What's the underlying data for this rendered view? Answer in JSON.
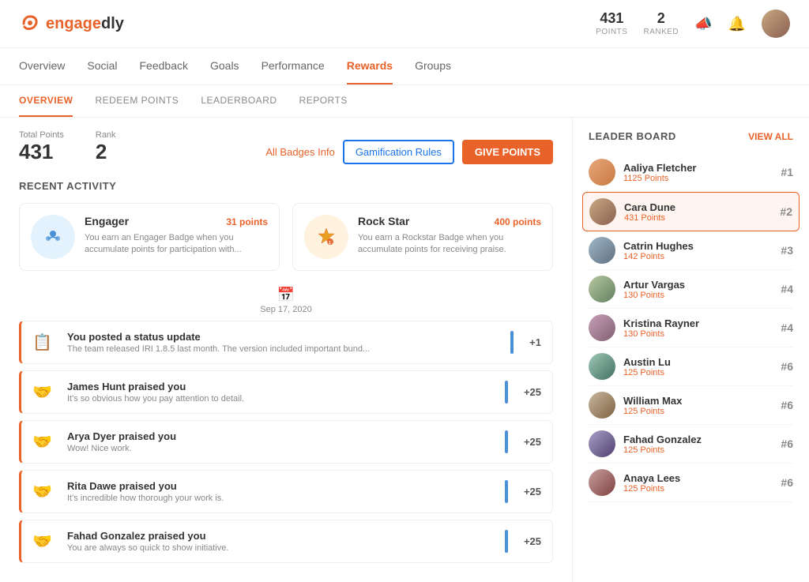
{
  "header": {
    "logo_text": "engagedly",
    "points_value": "431",
    "points_label": "POINTS",
    "ranked_value": "2",
    "ranked_label": "RANKED"
  },
  "main_nav": {
    "items": [
      {
        "label": "Overview",
        "active": false
      },
      {
        "label": "Social",
        "active": false
      },
      {
        "label": "Feedback",
        "active": false
      },
      {
        "label": "Goals",
        "active": false
      },
      {
        "label": "Performance",
        "active": false
      },
      {
        "label": "Rewards",
        "active": true
      },
      {
        "label": "Groups",
        "active": false
      }
    ]
  },
  "sub_nav": {
    "items": [
      {
        "label": "OVERVIEW",
        "active": true
      },
      {
        "label": "REDEEM POINTS",
        "active": false
      },
      {
        "label": "LEADERBOARD",
        "active": false
      },
      {
        "label": "REPORTS",
        "active": false
      }
    ]
  },
  "stats": {
    "total_points_label": "Total Points",
    "total_points_value": "431",
    "rank_label": "Rank",
    "rank_value": "2"
  },
  "buttons": {
    "all_badges_info": "All Badges Info",
    "gamification_rules": "Gamification Rules",
    "give_points": "GIVE POINTS"
  },
  "recent_activity": {
    "section_title": "RECENT ACTIVITY",
    "badges": [
      {
        "title": "Engager",
        "points": "31 points",
        "description": "You earn an Engager Badge when you accumulate points for participation with...",
        "icon_type": "blue"
      },
      {
        "title": "Rock Star",
        "points": "400 points",
        "description": "You earn a Rockstar Badge when you accumulate points for receiving praise.",
        "icon_type": "orange"
      }
    ],
    "date_label": "Sep 17, 2020",
    "activities": [
      {
        "title": "You posted a status update",
        "description": "The team released IRI 1.8.5 last month. The version included important bund...",
        "points": "+1",
        "icon": "📋"
      },
      {
        "title": "James Hunt praised you",
        "description": "It's so obvious how you pay attention to detail.",
        "points": "+25",
        "icon": "🤝"
      },
      {
        "title": "Arya Dyer praised you",
        "description": "Wow! Nice work.",
        "points": "+25",
        "icon": "🤝"
      },
      {
        "title": "Rita Dawe praised you",
        "description": "It's incredible how thorough your work is.",
        "points": "+25",
        "icon": "🤝"
      },
      {
        "title": "Fahad Gonzalez praised you",
        "description": "You are always so quick to show initiative.",
        "points": "+25",
        "icon": "🤝"
      }
    ]
  },
  "leaderboard": {
    "section_title": "LEADER BOARD",
    "view_all": "VIEW ALL",
    "items": [
      {
        "name": "Aaliya Fletcher",
        "points": "1125 Points",
        "rank": "#1",
        "highlighted": false,
        "av": "av1"
      },
      {
        "name": "Cara Dune",
        "points": "431 Points",
        "rank": "#2",
        "highlighted": true,
        "av": "av2"
      },
      {
        "name": "Catrin Hughes",
        "points": "142 Points",
        "rank": "#3",
        "highlighted": false,
        "av": "av3"
      },
      {
        "name": "Artur Vargas",
        "points": "130 Points",
        "rank": "#4",
        "highlighted": false,
        "av": "av4"
      },
      {
        "name": "Kristina Rayner",
        "points": "130 Points",
        "rank": "#4",
        "highlighted": false,
        "av": "av5"
      },
      {
        "name": "Austin Lu",
        "points": "125 Points",
        "rank": "#6",
        "highlighted": false,
        "av": "av6"
      },
      {
        "name": "William Max",
        "points": "125 Points",
        "rank": "#6",
        "highlighted": false,
        "av": "av7"
      },
      {
        "name": "Fahad Gonzalez",
        "points": "125 Points",
        "rank": "#6",
        "highlighted": false,
        "av": "av8"
      },
      {
        "name": "Anaya Lees",
        "points": "125 Points",
        "rank": "#6",
        "highlighted": false,
        "av": "av9"
      }
    ]
  }
}
